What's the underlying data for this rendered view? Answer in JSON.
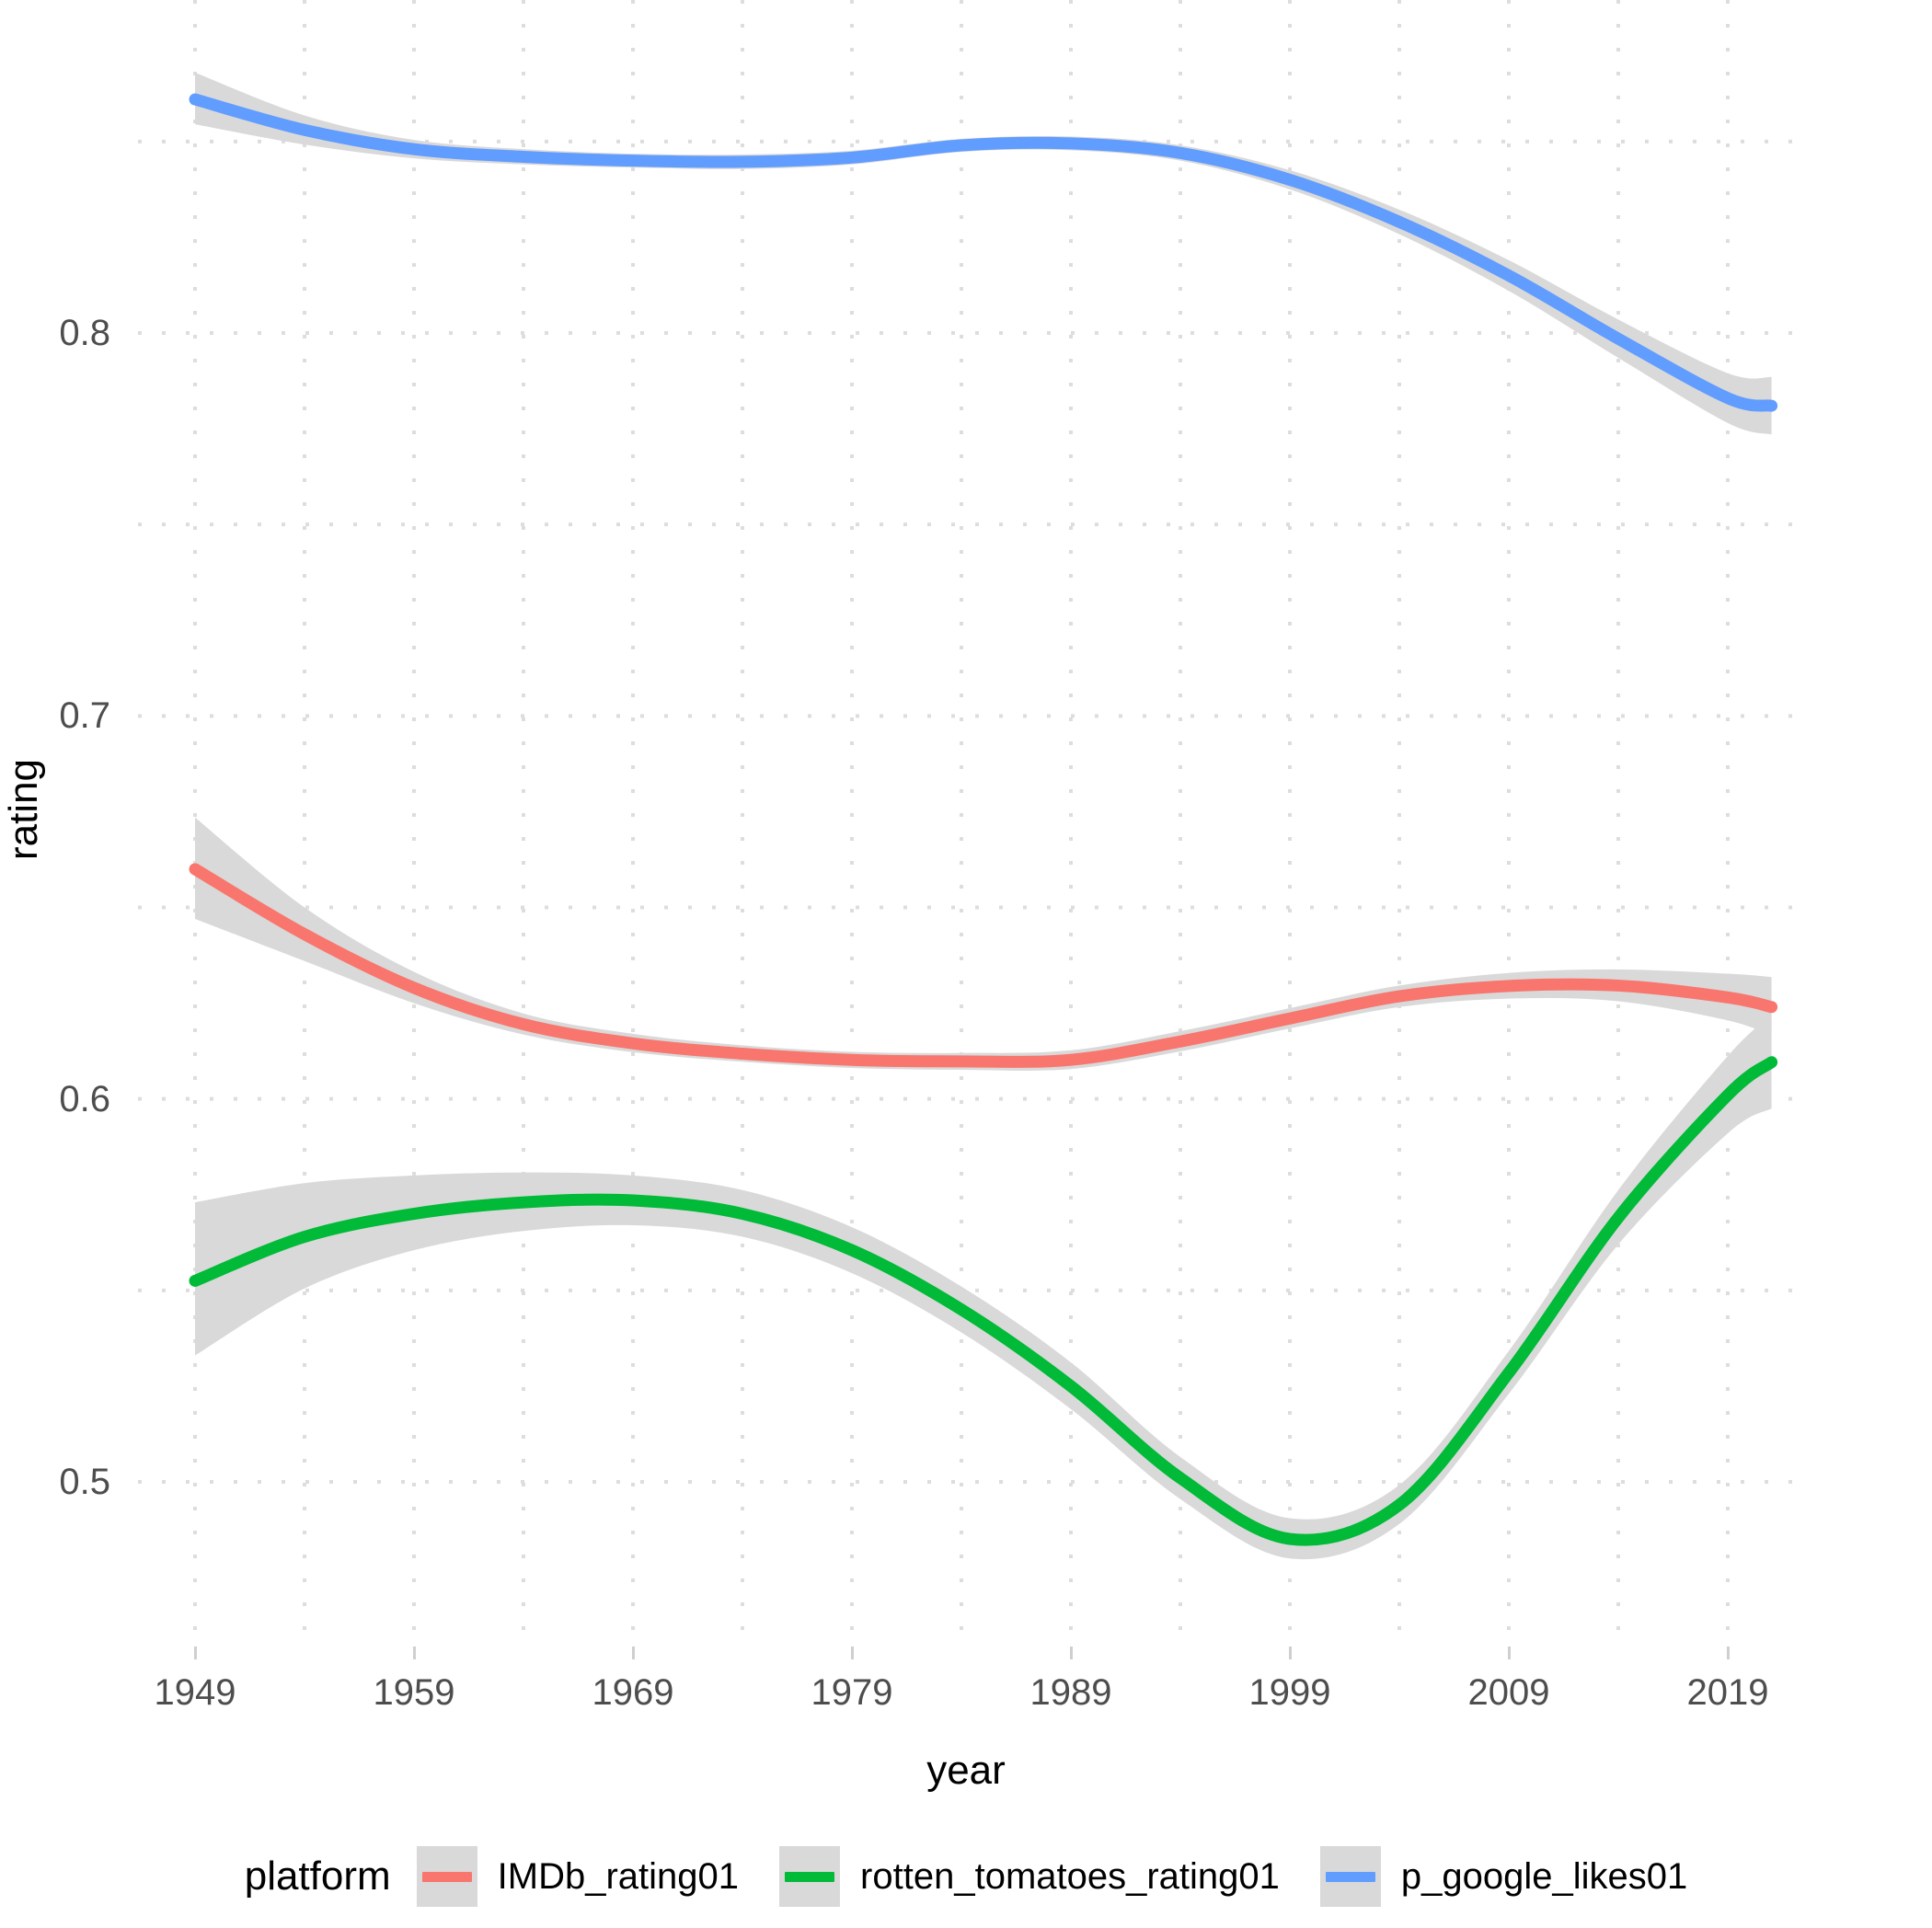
{
  "chart_data": {
    "type": "line",
    "title": "",
    "subtitle": "",
    "xlabel": "year",
    "ylabel": "rating",
    "xlim": [
      1949,
      2021
    ],
    "ylim": [
      0.4655,
      0.8695
    ],
    "grid": true,
    "legend_position": "bottom",
    "legend_title": "platform",
    "smoothing": "loess with standard-error ribbon",
    "xticks": [
      "1949",
      "1959",
      "1969",
      "1979",
      "1989",
      "1999",
      "2009",
      "2019"
    ],
    "xtick_values": [
      1949,
      1959,
      1969,
      1979,
      1989,
      1999,
      2009,
      2019
    ],
    "yticks": [
      "0.5",
      "0.6",
      "0.7",
      "0.8"
    ],
    "ytick_values": [
      0.5,
      0.6,
      0.7,
      0.8
    ],
    "x": [
      1949,
      1954,
      1959,
      1964,
      1969,
      1974,
      1979,
      1984,
      1989,
      1994,
      1999,
      2004,
      2009,
      2014,
      2019,
      2021
    ],
    "series": [
      {
        "name": "IMDb_rating01",
        "color": "#F8766D",
        "values": [
          0.66,
          0.643,
          0.629,
          0.6195,
          0.6145,
          0.6118,
          0.6102,
          0.6098,
          0.6102,
          0.615,
          0.621,
          0.6268,
          0.6295,
          0.6296,
          0.6265,
          0.624
        ],
        "ribbon_low": [
          0.647,
          0.636,
          0.625,
          0.6168,
          0.6122,
          0.6097,
          0.6081,
          0.6076,
          0.6078,
          0.6124,
          0.6184,
          0.624,
          0.6262,
          0.6255,
          0.6205,
          0.6165
        ],
        "ribbon_high": [
          0.6735,
          0.65,
          0.6332,
          0.6223,
          0.617,
          0.614,
          0.6123,
          0.612,
          0.6127,
          0.6177,
          0.6237,
          0.6296,
          0.6329,
          0.6338,
          0.6327,
          0.6318
        ]
      },
      {
        "name": "rotten_tomatoes_rating01",
        "color": "#00BA38",
        "values": [
          0.5525,
          0.564,
          0.57,
          0.573,
          0.5735,
          0.57,
          0.5605,
          0.545,
          0.525,
          0.501,
          0.4851,
          0.494,
          0.5285,
          0.569,
          0.601,
          0.6096
        ],
        "ribbon_low": [
          0.533,
          0.5505,
          0.5605,
          0.5655,
          0.567,
          0.564,
          0.5545,
          0.539,
          0.519,
          0.4955,
          0.48,
          0.489,
          0.523,
          0.562,
          0.591,
          0.5975
        ],
        "ribbon_high": [
          0.573,
          0.578,
          0.58,
          0.5808,
          0.58,
          0.5762,
          0.5665,
          0.551,
          0.5312,
          0.5065,
          0.4905,
          0.4992,
          0.5342,
          0.5762,
          0.6112,
          0.6218
        ]
      },
      {
        "name": "p_google_likes01",
        "color": "#619CFF",
        "values": [
          0.861,
          0.853,
          0.848,
          0.846,
          0.845,
          0.8447,
          0.8458,
          0.849,
          0.8495,
          0.847,
          0.84,
          0.829,
          0.815,
          0.7985,
          0.783,
          0.781
        ],
        "ribbon_low": [
          0.8545,
          0.8492,
          0.8456,
          0.844,
          0.8432,
          0.8428,
          0.844,
          0.8473,
          0.8477,
          0.845,
          0.8375,
          0.8258,
          0.811,
          0.7935,
          0.7765,
          0.7735
        ],
        "ribbon_high": [
          0.868,
          0.8568,
          0.8504,
          0.848,
          0.8468,
          0.8466,
          0.8476,
          0.8507,
          0.8513,
          0.849,
          0.8425,
          0.8322,
          0.819,
          0.8035,
          0.7895,
          0.7885
        ]
      }
    ],
    "ribbon_color": "#d9d9d9"
  },
  "axes": {
    "y_title": "rating",
    "x_title": "year",
    "y_tick_labels": [
      "0.8",
      "0.7",
      "0.6",
      "0.5"
    ],
    "x_tick_labels": [
      "1949",
      "1959",
      "1969",
      "1979",
      "1989",
      "1999",
      "2009",
      "2019"
    ]
  },
  "legend": {
    "title": "platform",
    "items": [
      {
        "label": "IMDb_rating01",
        "color": "#F8766D"
      },
      {
        "label": "rotten_tomatoes_rating01",
        "color": "#00BA38"
      },
      {
        "label": "p_google_likes01",
        "color": "#619CFF"
      }
    ]
  },
  "theme": {
    "background": "#FFFFFF",
    "grid_color": "#DDDDDD",
    "text_color": "#4D4D4D",
    "ribbon_color": "#D9D9D9"
  }
}
